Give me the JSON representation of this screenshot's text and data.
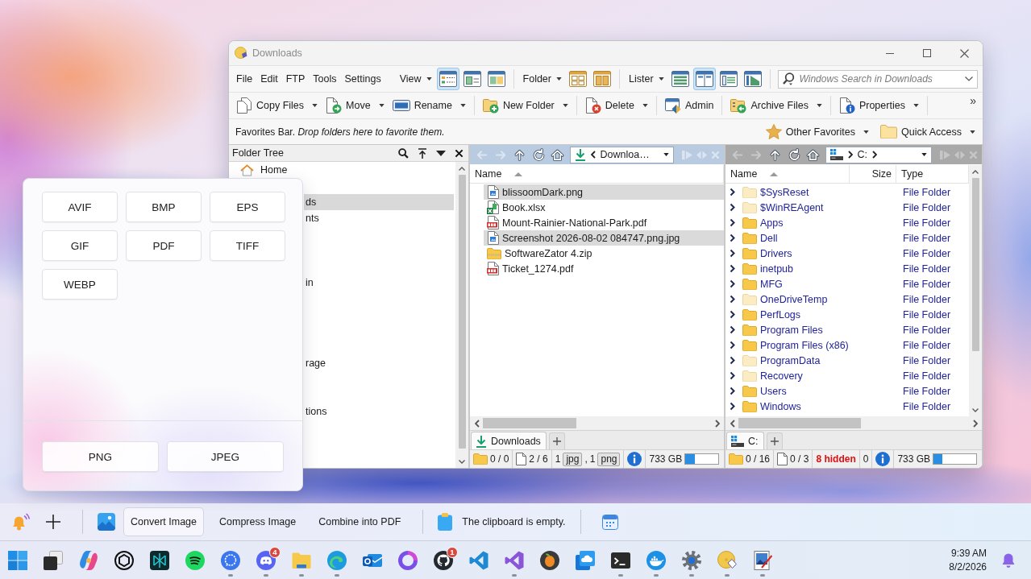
{
  "window": {
    "title": "Downloads"
  },
  "menu": [
    "File",
    "Edit",
    "FTP",
    "Tools",
    "Settings"
  ],
  "layout_groups": [
    {
      "label": "View",
      "kind": "view",
      "buttons": [
        {
          "selected": true
        },
        {
          "selected": false
        },
        {
          "selected": false
        }
      ]
    },
    {
      "label": "Folder",
      "kind": "folder",
      "buttons": [
        {
          "selected": false
        },
        {
          "selected": false
        }
      ]
    },
    {
      "label": "Lister",
      "kind": "lister",
      "buttons": [
        {
          "selected": false
        },
        {
          "selected": true
        },
        {
          "selected": false
        },
        {
          "selected": false
        }
      ]
    }
  ],
  "search": {
    "placeholder": "Windows Search in Downloads"
  },
  "command_groups": [
    [
      {
        "label": "Copy Files",
        "dropdown": true
      },
      {
        "label": "Move",
        "dropdown": true
      },
      {
        "label": "Rename",
        "dropdown": true
      }
    ],
    [
      {
        "label": "New Folder",
        "dropdown": true
      }
    ],
    [
      {
        "label": "Delete",
        "dropdown": true
      }
    ],
    [
      {
        "label": "Admin",
        "dropdown": false
      }
    ],
    [
      {
        "label": "Archive Files",
        "dropdown": true
      }
    ],
    [
      {
        "label": "Properties",
        "dropdown": true
      }
    ]
  ],
  "overflow": "»",
  "favorites_bar": {
    "text": "Favorites Bar. *Drop folders here to favorite them.*",
    "menus": [
      {
        "label": "Other Favorites",
        "kind": "star"
      },
      {
        "label": "Quick Access",
        "kind": "folder"
      }
    ]
  },
  "folder_tree": {
    "title": "Folder Tree",
    "items": [
      {
        "label": "Home",
        "kind": "home",
        "selected": false
      },
      {
        "label": "ds",
        "kind": "clipped",
        "selected": true
      },
      {
        "label": "nts",
        "kind": "clipped",
        "selected": false
      },
      {
        "label": "in",
        "kind": "clipped",
        "selected": false
      },
      {
        "label": "rage",
        "kind": "clipped",
        "selected": false
      },
      {
        "label": "tions",
        "kind": "clipped",
        "selected": false
      }
    ]
  },
  "listers": [
    {
      "active": true,
      "nav_buttons": [
        {
          "kind": "back",
          "disabled": true
        },
        {
          "kind": "forward",
          "disabled": true
        },
        {
          "kind": "up",
          "disabled": false
        },
        {
          "kind": "refresh",
          "disabled": false
        },
        {
          "kind": "home",
          "disabled": false
        }
      ],
      "location": {
        "kind": "downloads",
        "label": "Downloa…"
      },
      "columns": [
        {
          "label": "Name",
          "sorted": true
        }
      ],
      "rows": [
        {
          "name": "blissoomDark.png",
          "kind": "image",
          "selected": true
        },
        {
          "name": "Book.xlsx",
          "kind": "spreadsheet",
          "selected": false
        },
        {
          "name": "Mount-Rainier-National-Park.pdf",
          "kind": "pdf",
          "selected": false
        },
        {
          "name": "Screenshot 2026-08-02 084747.png.jpg",
          "kind": "image",
          "selected": true
        },
        {
          "name": "SoftwareZator 4.zip",
          "kind": "archive",
          "selected": false
        },
        {
          "name": "Ticket_1274.pdf",
          "kind": "pdf",
          "selected": false
        }
      ],
      "tabs": [
        {
          "label": "Downloads",
          "kind": "downloads",
          "selected": true
        }
      ],
      "status": {
        "folders": "0 / 0",
        "files": "2 / 6",
        "types": [
          {
            "count": "1",
            "ext": "jpg"
          },
          {
            "count": "1",
            "ext": "png"
          }
        ],
        "separator": ",",
        "free": "733 GB",
        "level": 0.3
      }
    },
    {
      "active": false,
      "nav_buttons": [
        {
          "kind": "back",
          "disabled": true
        },
        {
          "kind": "forward",
          "disabled": true
        },
        {
          "kind": "up",
          "disabled": false
        },
        {
          "kind": "refresh",
          "disabled": false
        },
        {
          "kind": "home",
          "disabled": false
        }
      ],
      "location": {
        "kind": "drive",
        "label": "C:"
      },
      "columns": [
        {
          "label": "Name",
          "sorted": true
        },
        {
          "label": "Size",
          "sorted": false
        },
        {
          "label": "Type",
          "sorted": false
        }
      ],
      "rows": [
        {
          "name": "$SysReset",
          "kind": "folder",
          "hidden": true,
          "expanded": false,
          "type": "File Folder",
          "selected": false
        },
        {
          "name": "$WinREAgent",
          "kind": "folder",
          "hidden": true,
          "expanded": false,
          "type": "File Folder",
          "selected": false
        },
        {
          "name": "Apps",
          "kind": "folder",
          "hidden": false,
          "expanded": false,
          "type": "File Folder",
          "selected": false
        },
        {
          "name": "Dell",
          "kind": "folder",
          "hidden": false,
          "expanded": false,
          "type": "File Folder",
          "selected": false
        },
        {
          "name": "Drivers",
          "kind": "folder",
          "hidden": false,
          "expanded": false,
          "type": "File Folder",
          "selected": false
        },
        {
          "name": "inetpub",
          "kind": "folder",
          "hidden": false,
          "expanded": false,
          "type": "File Folder",
          "selected": false
        },
        {
          "name": "MFG",
          "kind": "folder",
          "hidden": false,
          "expanded": false,
          "type": "File Folder",
          "selected": false
        },
        {
          "name": "OneDriveTemp",
          "kind": "folder",
          "hidden": true,
          "expanded": false,
          "type": "File Folder",
          "selected": false
        },
        {
          "name": "PerfLogs",
          "kind": "folder",
          "hidden": false,
          "expanded": false,
          "type": "File Folder",
          "selected": false
        },
        {
          "name": "Program Files",
          "kind": "folder",
          "hidden": false,
          "expanded": false,
          "type": "File Folder",
          "selected": false
        },
        {
          "name": "Program Files (x86)",
          "kind": "folder",
          "hidden": false,
          "expanded": false,
          "type": "File Folder",
          "selected": false
        },
        {
          "name": "ProgramData",
          "kind": "folder",
          "hidden": true,
          "expanded": false,
          "type": "File Folder",
          "selected": false
        },
        {
          "name": "Recovery",
          "kind": "folder",
          "hidden": true,
          "expanded": false,
          "type": "File Folder",
          "selected": false
        },
        {
          "name": "Users",
          "kind": "folder",
          "hidden": false,
          "expanded": false,
          "type": "File Folder",
          "selected": false
        },
        {
          "name": "Windows",
          "kind": "folder",
          "hidden": false,
          "expanded": false,
          "type": "File Folder",
          "selected": false
        }
      ],
      "tabs": [
        {
          "label": "C:",
          "kind": "drive",
          "selected": true
        }
      ],
      "status": {
        "folders": "0 / 16",
        "files": "0 / 3",
        "hidden": "8 hidden",
        "count": "0",
        "free": "733 GB",
        "level": 0.21
      }
    }
  ],
  "converter": {
    "formats": [
      "AVIF",
      "BMP",
      "EPS",
      "GIF",
      "PDF",
      "TIFF",
      "WEBP"
    ],
    "targets": [
      "PNG",
      "JPEG"
    ]
  },
  "action_bar": {
    "actions": [
      {
        "label": "Convert Image",
        "selected": true
      },
      {
        "label": "Compress Image",
        "selected": false
      },
      {
        "label": "Combine into PDF",
        "selected": false
      }
    ],
    "clipboard": "The clipboard is empty."
  },
  "taskbar": {
    "apps": [
      {
        "kind": "four_squares",
        "running": false
      },
      {
        "kind": "stacked_squares",
        "running": false
      },
      {
        "kind": "swirl",
        "running": false
      },
      {
        "kind": "hexagon_ring",
        "running": false
      },
      {
        "kind": "starburst",
        "running": false
      },
      {
        "kind": "wave_lines",
        "running": false
      },
      {
        "kind": "speech_bubble",
        "running": true
      },
      {
        "kind": "controller",
        "running": true,
        "badge": "4"
      },
      {
        "kind": "folder",
        "running": true
      },
      {
        "kind": "wave_circle",
        "running": true
      },
      {
        "kind": "envelope",
        "running": false
      },
      {
        "kind": "ring",
        "running": false
      },
      {
        "kind": "silhouette",
        "running": false,
        "badge": "1"
      },
      {
        "kind": "ribbon",
        "running": false
      },
      {
        "kind": "infinity_ribbon",
        "running": true
      },
      {
        "kind": "fruit",
        "running": false
      },
      {
        "kind": "cloud",
        "running": false
      },
      {
        "kind": "terminal",
        "running": true
      },
      {
        "kind": "whale",
        "running": true
      },
      {
        "kind": "gear",
        "running": true
      },
      {
        "kind": "disc",
        "running": true
      },
      {
        "kind": "picture_pen",
        "running": true
      }
    ],
    "clock": {
      "time": "9:39 AM",
      "date": "8/2/2026"
    }
  }
}
